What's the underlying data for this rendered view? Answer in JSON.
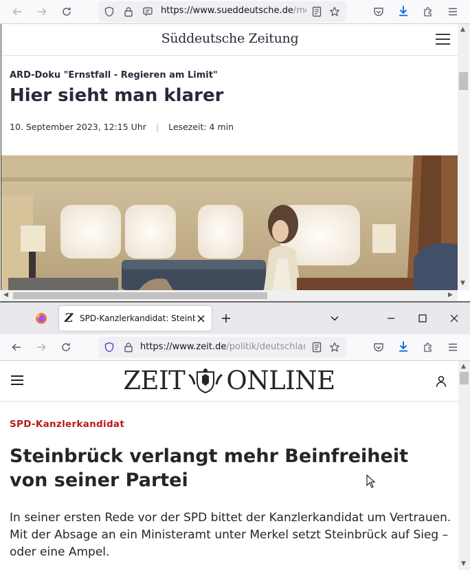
{
  "window1": {
    "url_domain": "https://www.sueddeutsche.de",
    "url_rest": "/medien/",
    "site_logo": "Süddeutsche Zeitung",
    "article": {
      "kicker": "ARD-Doku \"Ernstfall - Regieren am Limit\"",
      "headline": "Hier sieht man klarer",
      "date": "10. September 2023, 12:15 Uhr",
      "separator": "|",
      "reading_time": "Lesezeit: 4 min"
    }
  },
  "window2": {
    "tab_title": "SPD-Kanzlerkandidat: Steinbrück",
    "url_domain": "https://www.zeit.de",
    "url_rest": "/politik/deutschland/",
    "logo_left": "ZEIT",
    "logo_right": "ONLINE",
    "article": {
      "kicker": "SPD-Kanzlerkandidat",
      "headline": "Steinbrück verlangt mehr Beinfreiheit von seiner Partei",
      "lede": "In seiner ersten Rede vor der SPD bittet der Kanzlerkandidat um Vertrauen. Mit der Absage an ein Ministeramt unter Merkel setzt Steinbrück auf Sieg – oder eine Ampel."
    }
  },
  "colors": {
    "zeit_kicker": "#b9191b",
    "firefox_accent": "#0061e0"
  }
}
